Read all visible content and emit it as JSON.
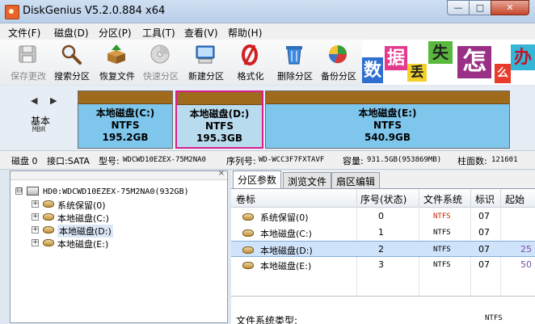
{
  "window": {
    "title": "DiskGenius V5.2.0.884 x64",
    "min_glyph": "—",
    "max_glyph": "□",
    "close_glyph": "✕"
  },
  "menu": [
    "文件(F)",
    "磁盘(D)",
    "分区(P)",
    "工具(T)",
    "查看(V)",
    "帮助(H)"
  ],
  "toolbar": [
    {
      "label": "保存更改",
      "icon": "save-icon",
      "enabled": false
    },
    {
      "label": "搜索分区",
      "icon": "magnifier-icon",
      "enabled": true
    },
    {
      "label": "恢复文件",
      "icon": "recover-box-icon",
      "enabled": true
    },
    {
      "label": "快速分区",
      "icon": "quick-partition-disk-icon",
      "enabled": false
    },
    {
      "label": "新建分区",
      "icon": "new-partition-computer-icon",
      "enabled": true
    },
    {
      "label": "格式化",
      "icon": "format-red-icon",
      "enabled": true
    },
    {
      "label": "删除分区",
      "icon": "delete-bin-icon",
      "enabled": true
    },
    {
      "label": "备份分区",
      "icon": "backup-pie-icon",
      "enabled": true
    }
  ],
  "banner": {
    "chars": [
      "数",
      "据",
      "丢",
      "失",
      "怎",
      "么",
      "办"
    ]
  },
  "disk_map": {
    "nav_arrows": "◀ ▶",
    "basic_label": "基本",
    "mbr_label": "MBR",
    "partitions": [
      {
        "name": "本地磁盘(C:)",
        "fs": "NTFS",
        "size": "195.2GB",
        "selected": false
      },
      {
        "name": "本地磁盘(D:)",
        "fs": "NTFS",
        "size": "195.3GB",
        "selected": true
      },
      {
        "name": "本地磁盘(E:)",
        "fs": "NTFS",
        "size": "540.9GB",
        "selected": false
      }
    ]
  },
  "info": {
    "disk": "磁盘 0",
    "interface": "接口:SATA",
    "model_label": "型号:",
    "model": "WDCWD10EZEX-75M2NA0",
    "serial_label": "序列号:",
    "serial": "WD-WCC3F7FXTAVF",
    "capacity_label": "容量:",
    "capacity": "931.5GB(953869MB)",
    "cyl_label": "柱面数:",
    "cylinders": "121601"
  },
  "tree": {
    "root": "HD0:WDCWD10EZEX-75M2NA0(932GB)",
    "root_expander": "⊟",
    "child_expander": "+",
    "close_glyph": "×",
    "children": [
      "系统保留(0)",
      "本地磁盘(C:)",
      "本地磁盘(D:)",
      "本地磁盘(E:)"
    ],
    "selected_index": 2
  },
  "tabs": [
    "分区参数",
    "浏览文件",
    "扇区编辑"
  ],
  "active_tab": 0,
  "grid": {
    "headers": [
      "卷标",
      "序号(状态)",
      "文件系统",
      "标识",
      "起始"
    ],
    "rows": [
      {
        "label": "系统保留(0)",
        "index": "0",
        "fs": "NTFS",
        "id": "07",
        "start": ""
      },
      {
        "label": "本地磁盘(C:)",
        "index": "1",
        "fs": "NTFS",
        "id": "07",
        "start": ""
      },
      {
        "label": "本地磁盘(D:)",
        "index": "2",
        "fs": "NTFS",
        "id": "07",
        "start": "25"
      },
      {
        "label": "本地磁盘(E:)",
        "index": "3",
        "fs": "NTFS",
        "id": "07",
        "start": "50"
      }
    ],
    "selected_row": 2
  },
  "details": {
    "fs_type_label": "文件系统类型:",
    "fs_type_value": "NTFS"
  },
  "colors": {
    "accent_selected": "#d61f8b",
    "partition_fill": "#7ec6ec",
    "partition_cap": "#a06a1c",
    "ntfs_red": "#cc2200"
  }
}
